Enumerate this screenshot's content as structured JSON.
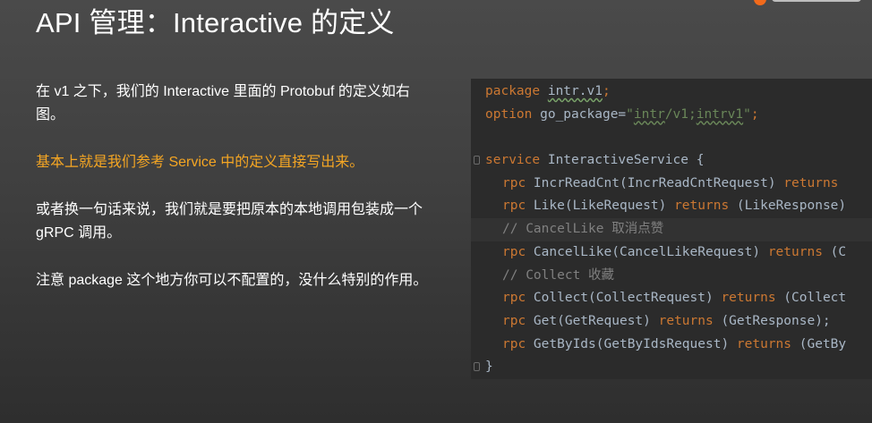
{
  "slide": {
    "title": "API 管理：Interactive 的定义",
    "paragraphs": [
      "在 v1 之下，我们的 Interactive 里面的 Protobuf 的定义如右图。",
      "基本上就是我们参考 Service 中的定义直接写出来。",
      "或者换一句话来说，我们就是要把原本的本地调用包装成一个 gRPC 调用。",
      "注意 package 这个地方你可以不配置的，没什么特别的作用。"
    ],
    "highlight_color": "#f5a623",
    "logo_color": "#f26a1b"
  },
  "code": {
    "l1_kw": "package",
    "l1_name": "intr.v1",
    "l1_end": ";",
    "l2_kw": "option",
    "l2_name": " go_package=",
    "l2_str_q1": "\"",
    "l2_str_a": "intr",
    "l2_str_b": "/v1;",
    "l2_str_c": "intrv1",
    "l2_str_q2": "\"",
    "l2_end": ";",
    "l4_kw": "service",
    "l4_rest": " InteractiveService {",
    "rpc_kw": "rpc",
    "returns_kw": "returns",
    "l5_sig": " IncrReadCnt(IncrReadCntRequest) ",
    "l6_sig": " Like(LikeRequest) ",
    "l6_tail": " (LikeResponse)",
    "l7_comment": "// CancelLike 取消点赞",
    "l8_sig": " CancelLike(CancelLikeRequest) ",
    "l8_tail": " (C",
    "l9_comment": "// Collect 收藏",
    "l10_sig": " Collect(CollectRequest) ",
    "l10_tail": " (Collect",
    "l11_sig": " Get(GetRequest) ",
    "l11_tail": " (GetResponse);",
    "l12_sig": " GetByIds(GetByIdsRequest) ",
    "l12_tail": " (GetBy",
    "l13_close": "}"
  }
}
